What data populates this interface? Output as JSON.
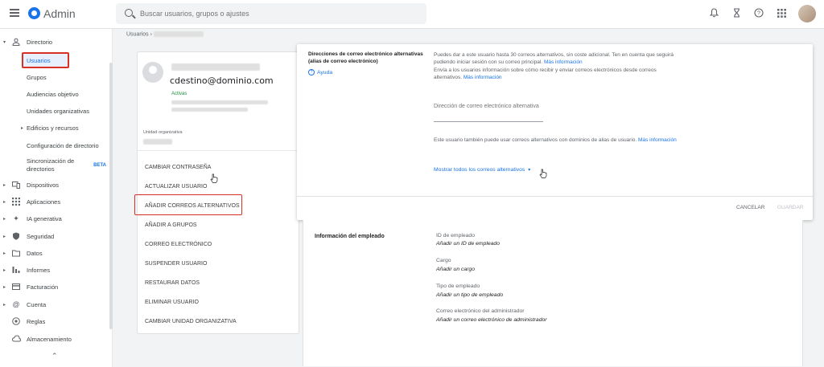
{
  "header": {
    "app_title": "Admin",
    "search_placeholder": "Buscar usuarios, grupos o ajustes"
  },
  "sidebar": {
    "items": [
      {
        "label": "Directorio",
        "icon": "person-icon"
      },
      {
        "label": "Usuarios"
      },
      {
        "label": "Grupos"
      },
      {
        "label": "Audiencias objetivo"
      },
      {
        "label": "Unidades organizativas"
      },
      {
        "label": "Edificios y recursos"
      },
      {
        "label": "Configuración de directorio"
      },
      {
        "label": "Sincronización de directorios",
        "badge": "BETA"
      },
      {
        "label": "Dispositivos",
        "icon": "devices-icon"
      },
      {
        "label": "Aplicaciones",
        "icon": "apps-icon"
      },
      {
        "label": "IA generativa",
        "icon": "sparkle-icon"
      },
      {
        "label": "Seguridad",
        "icon": "shield-icon"
      },
      {
        "label": "Datos",
        "icon": "folder-icon"
      },
      {
        "label": "Informes",
        "icon": "bar-chart-icon"
      },
      {
        "label": "Facturación",
        "icon": "card-icon"
      },
      {
        "label": "Cuenta",
        "icon": "at-icon"
      },
      {
        "label": "Reglas",
        "icon": "rules-icon"
      },
      {
        "label": "Almacenamiento",
        "icon": "cloud-icon"
      }
    ]
  },
  "breadcrumb": {
    "root": "Usuarios"
  },
  "user": {
    "email": "cdestino@dominio.com",
    "status": "Activas",
    "org_unit_label": "Unidad organizativa"
  },
  "actions": [
    "CAMBIAR CONTRASEÑA",
    "ACTUALIZAR USUARIO",
    "AÑADIR CORREOS ALTERNATIVOS",
    "AÑADIR A GRUPOS",
    "CORREO ELECTRÓNICO",
    "SUSPENDER USUARIO",
    "RESTAURAR DATOS",
    "ELIMINAR USUARIO",
    "CAMBIAR UNIDAD ORGANIZATIVA"
  ],
  "alt_emails": {
    "title": "Direcciones de correo electrónico alternativas (alias de correo electrónico)",
    "help": "Ayuda",
    "desc1": "Puedes dar a este usuario hasta 30 correos alternativos, sin coste adicional. Ten en cuenta que seguirá pudiendo iniciar sesión con su correo principal.",
    "desc1_link": "Más información",
    "desc2": "Envía a los usuarios información sobre cómo recibir y enviar correos electrónicos desde correos alternativos.",
    "desc2_link": "Más información",
    "input_placeholder": "Dirección de correo electrónico alternativa",
    "desc3": "Este usuario también puede usar correos alternativos con dominios de alias de usuario.",
    "desc3_link": "Más información",
    "show_all": "Mostrar todos los correos alternativos",
    "cancel": "CANCELAR",
    "save": "GUARDAR"
  },
  "employee": {
    "title": "Información del empleado",
    "fields": [
      {
        "label": "ID de empleado",
        "value": "Añadir un ID de empleado"
      },
      {
        "label": "Cargo",
        "value": "Añadir un cargo"
      },
      {
        "label": "Tipo de empleado",
        "value": "Añadir un tipo de empleado"
      },
      {
        "label": "Correo electrónico del administrador",
        "value": "Añadir un correo electrónico de administrador"
      }
    ]
  },
  "colors": {
    "accent": "#1a73e8",
    "highlight_box": "#d93025",
    "active_status": "#1e8e3e"
  }
}
